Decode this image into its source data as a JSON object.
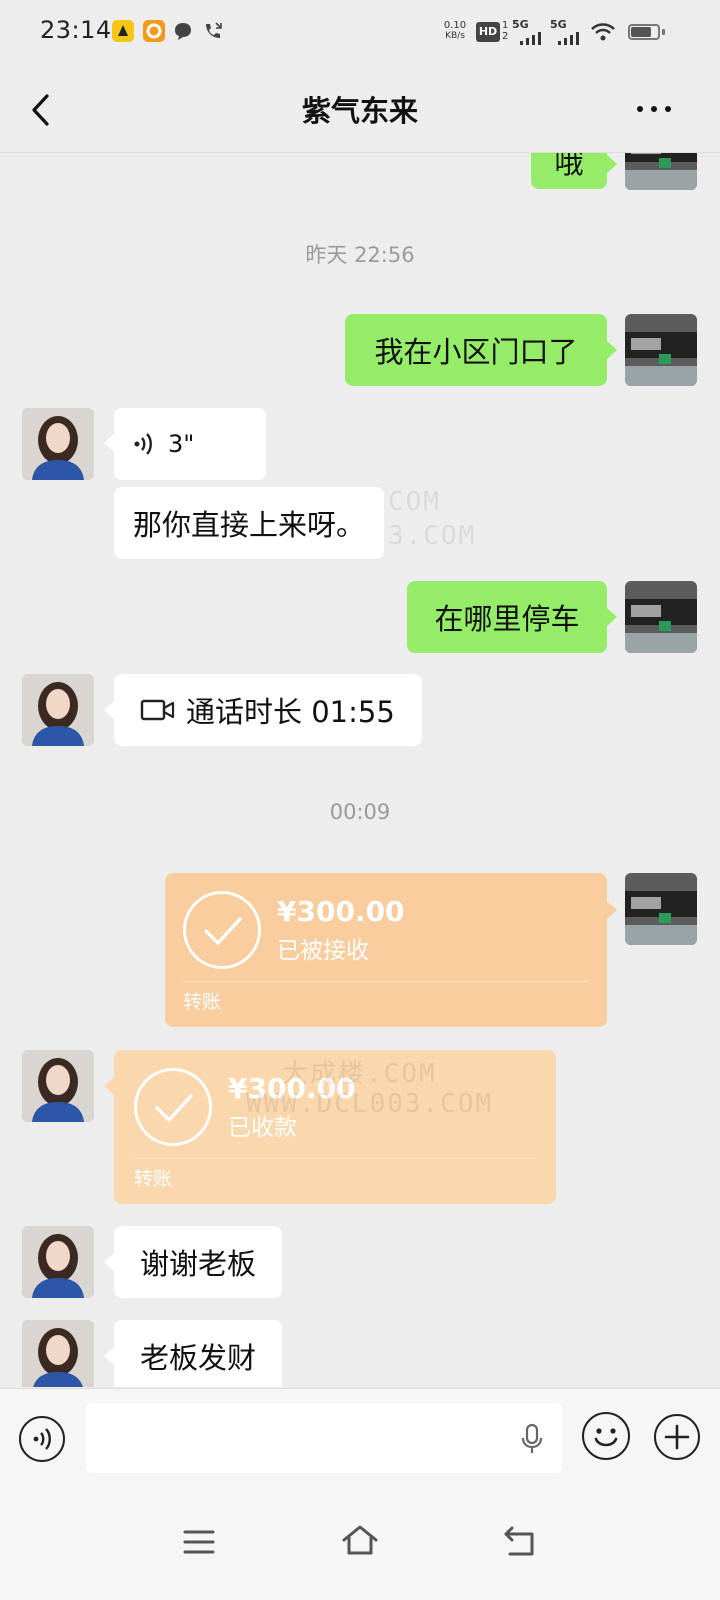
{
  "status_bar": {
    "time": "23:14",
    "net_speed_value": "0.10",
    "net_speed_unit": "KB/s",
    "hd_label": "HD",
    "sim1_label": "1",
    "sim2_label": "2",
    "signal1_label": "5G",
    "signal2_label": "5G",
    "battery_level": 0.75,
    "app_icons": [
      "app-icon-yellow",
      "app-icon-orange",
      "chat-bubble-icon",
      "missed-call-icon"
    ]
  },
  "header": {
    "title": "紫气东来",
    "back_icon": "chevron-left-icon",
    "more_icon": "more-dots-icon"
  },
  "messages": {
    "top_partial": {
      "text": "哦",
      "side": "sent"
    },
    "ts1": "昨天 22:56",
    "m1": {
      "text": "我在小区门口了",
      "side": "sent"
    },
    "m2": {
      "duration": "3\"",
      "side": "received",
      "type": "voice"
    },
    "m3": {
      "text": "那你直接上来呀。",
      "side": "received"
    },
    "m4": {
      "text": "在哪里停车",
      "side": "sent"
    },
    "m5": {
      "text": "通话时长 01:55",
      "side": "received",
      "type": "video-call"
    },
    "ts2": "00:09",
    "t1": {
      "amount": "¥300.00",
      "status": "已被接收",
      "label": "转账",
      "side": "sent"
    },
    "t2": {
      "amount": "¥300.00",
      "status": "已收款",
      "label": "转账",
      "side": "received"
    },
    "m6": {
      "text": "谢谢老板",
      "side": "received"
    },
    "m7": {
      "text": "老板发财",
      "side": "received"
    }
  },
  "watermark": {
    "line1a": "COM",
    "line1b": "3.COM",
    "line2a": "大成楼.COM",
    "line2b": "WWW.DCL003.COM"
  },
  "input_bar": {
    "voice_icon": "voice-icon",
    "mic_icon": "mic-icon",
    "emoji_icon": "emoji-icon",
    "plus_icon": "plus-icon",
    "value": ""
  },
  "nav_bar": {
    "icons": [
      "menu-icon",
      "home-icon",
      "back-icon"
    ]
  },
  "colors": {
    "background": "#ededed",
    "sent_bubble": "#95ec69",
    "received_bubble": "#ffffff",
    "transfer_sent": "#f9cd9d",
    "transfer_received": "#fad7ac"
  }
}
